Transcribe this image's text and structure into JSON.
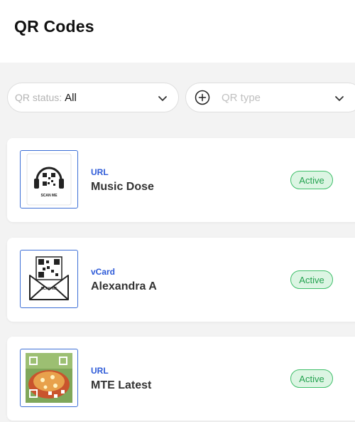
{
  "header": {
    "title": "QR Codes"
  },
  "filters": {
    "status": {
      "label": "QR status:",
      "value": "All"
    },
    "type": {
      "placeholder": "QR type"
    }
  },
  "cards": [
    {
      "type": "URL",
      "name": "Music Dose",
      "status": "Active",
      "thumb_caption": "SCAN ME"
    },
    {
      "type": "vCard",
      "name": "Alexandra A",
      "status": "Active",
      "thumb_caption": "SCAN ME"
    },
    {
      "type": "URL",
      "name": "MTE Latest",
      "status": "Active"
    }
  ],
  "colors": {
    "accent": "#2e5bd8",
    "active_border": "#3fbf6a",
    "active_bg": "#dcf5e3",
    "active_text": "#23a24f"
  }
}
